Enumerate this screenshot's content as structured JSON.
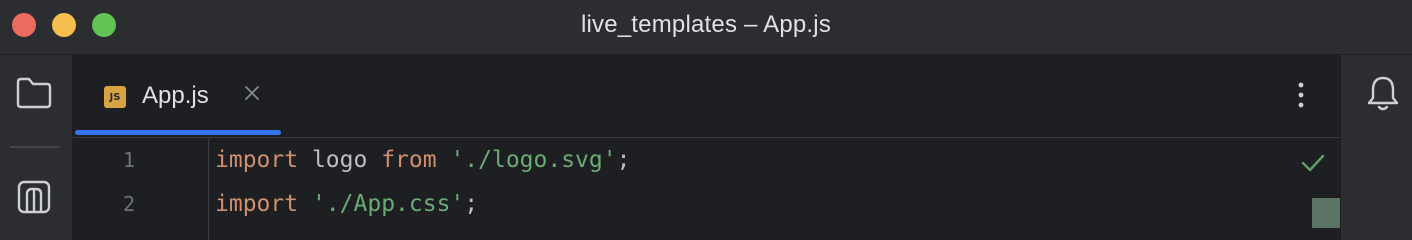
{
  "window": {
    "title": "live_templates – App.js",
    "traffic_lights": {
      "close_color": "#ec6a5e",
      "minimize_color": "#f4bf4f",
      "zoom_color": "#61c554"
    }
  },
  "left_toolbar": {
    "items": [
      {
        "icon": "folder-icon",
        "name": "project"
      },
      {
        "icon": "structure-icon",
        "name": "structure"
      }
    ]
  },
  "right_toolbar": {
    "items": [
      {
        "icon": "bell-icon",
        "name": "notifications"
      }
    ]
  },
  "editor": {
    "tabs": [
      {
        "label": "App.js",
        "icon_text": "JS",
        "active": true,
        "closable": true
      }
    ],
    "lines": [
      {
        "number": "1",
        "tokens": [
          {
            "text": "import",
            "type": "keyword"
          },
          {
            "text": " logo ",
            "type": "identifier"
          },
          {
            "text": "from",
            "type": "keyword"
          },
          {
            "text": " ",
            "type": "identifier"
          },
          {
            "text": "'./logo.svg'",
            "type": "string"
          },
          {
            "text": ";",
            "type": "identifier"
          }
        ]
      },
      {
        "number": "2",
        "tokens": [
          {
            "text": "import",
            "type": "keyword"
          },
          {
            "text": " ",
            "type": "identifier"
          },
          {
            "text": "'./App.css'",
            "type": "string"
          },
          {
            "text": ";",
            "type": "identifier"
          }
        ]
      }
    ],
    "inspection_status": "check-icon",
    "colors": {
      "keyword": "#cf8e6d",
      "string": "#6aab73",
      "identifier": "#bcbec4",
      "active_tab_underline": "#3574f0"
    }
  }
}
